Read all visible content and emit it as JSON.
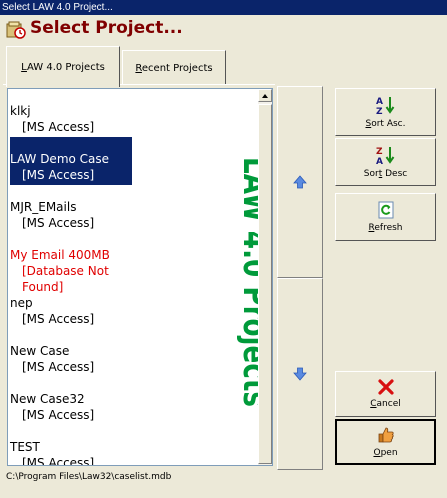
{
  "window": {
    "title": "Select LAW 4.0 Project..."
  },
  "header": {
    "title": "Select Project..."
  },
  "tabs": [
    {
      "label": "LAW 4.0 Projects",
      "underline": "L",
      "rest": "AW 4.0 Projects",
      "active": true
    },
    {
      "label": "Recent Projects",
      "underline": "R",
      "rest": "ecent Projects",
      "active": false
    }
  ],
  "projects": [
    {
      "name": "klkj",
      "sub": "[MS Access]",
      "selected": false,
      "error": false
    },
    {
      "name": "LAW Demo Case",
      "sub": "[MS Access]",
      "selected": true,
      "error": false
    },
    {
      "name": "MJR_EMails",
      "sub": "[MS Access]",
      "selected": false,
      "error": false
    },
    {
      "name": "My Email 400MB",
      "sub": "[Database Not Found]",
      "selected": false,
      "error": true
    },
    {
      "name": "nep",
      "sub": "[MS Access]",
      "selected": false,
      "error": false
    },
    {
      "name": "New Case",
      "sub": "[MS Access]",
      "selected": false,
      "error": false
    },
    {
      "name": "New Case32",
      "sub": "[MS Access]",
      "selected": false,
      "error": false
    },
    {
      "name": "TEST",
      "sub": "[MS Access]",
      "selected": false,
      "error": false
    }
  ],
  "watermark": "LAW 4.0 Projects",
  "buttons": {
    "sort_asc": {
      "label": "Sort Asc.",
      "pre": "",
      "ul": "S",
      "post": "ort Asc."
    },
    "sort_desc": {
      "label": "Sort Desc",
      "pre": "Sor",
      "ul": "t",
      "post": " Desc"
    },
    "refresh": {
      "label": "Refresh",
      "pre": "",
      "ul": "R",
      "post": "efresh"
    },
    "cancel": {
      "label": "Cancel",
      "pre": "",
      "ul": "C",
      "post": "ancel"
    },
    "open": {
      "label": "Open",
      "pre": "",
      "ul": "O",
      "post": "pen"
    }
  },
  "status": {
    "path": "C:\\Program Files\\Law32\\caselist.mdb"
  },
  "colors": {
    "selected_bg": "#0a246a",
    "error_text": "#e00000",
    "watermark": "#009a3a",
    "title_text": "#800000"
  }
}
